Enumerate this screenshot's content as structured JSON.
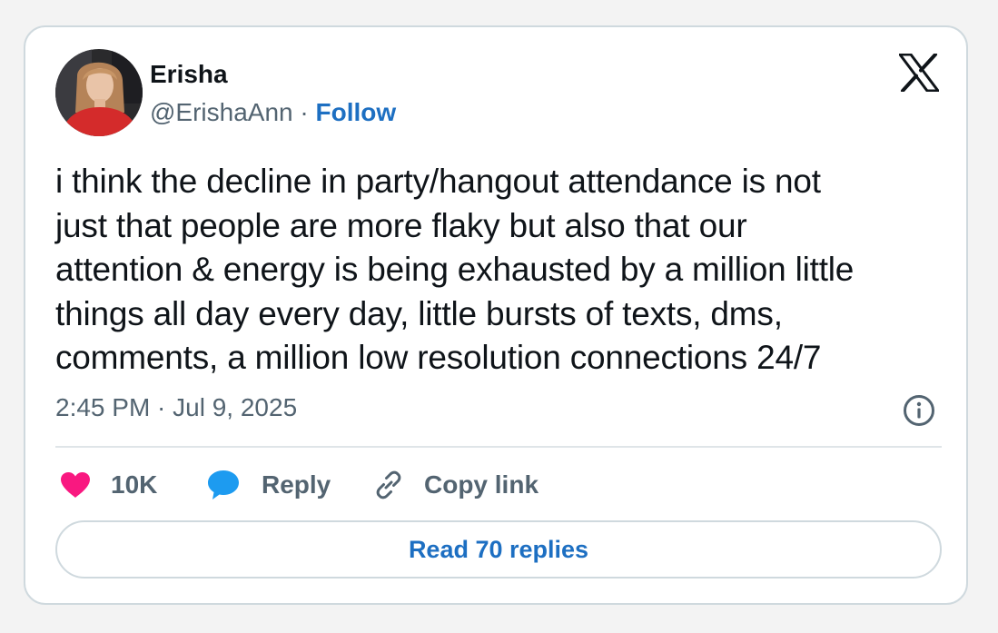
{
  "author": {
    "display_name": "Erisha",
    "handle": "@ErishaAnn",
    "separator": "·",
    "follow_label": "Follow"
  },
  "brand": {
    "icon": "x-logo-icon"
  },
  "tweet": {
    "text_lines": [
      "i think the decline in party/hangout attendance is not",
      "just that people are more flaky but also that our",
      "attention & energy is being exhausted by a million little",
      "things all day every day, little bursts of texts, dms,",
      "comments, a million low resolution connections 24/7"
    ],
    "timestamp": "2:45 PM · Jul 9, 2025"
  },
  "actions": {
    "like_count": "10K",
    "reply_label": "Reply",
    "copy_link_label": "Copy link",
    "read_replies_label": "Read 70 replies"
  },
  "icons": {
    "like": "heart-icon",
    "reply": "speech-bubble-icon",
    "copy": "link-icon",
    "info": "info-icon"
  },
  "colors": {
    "like": "#f91880",
    "reply": "#1d9bf0",
    "link": "#1d6fc2",
    "secondary_text": "#536471",
    "primary_text": "#0f1419",
    "border": "#cfd9de"
  }
}
